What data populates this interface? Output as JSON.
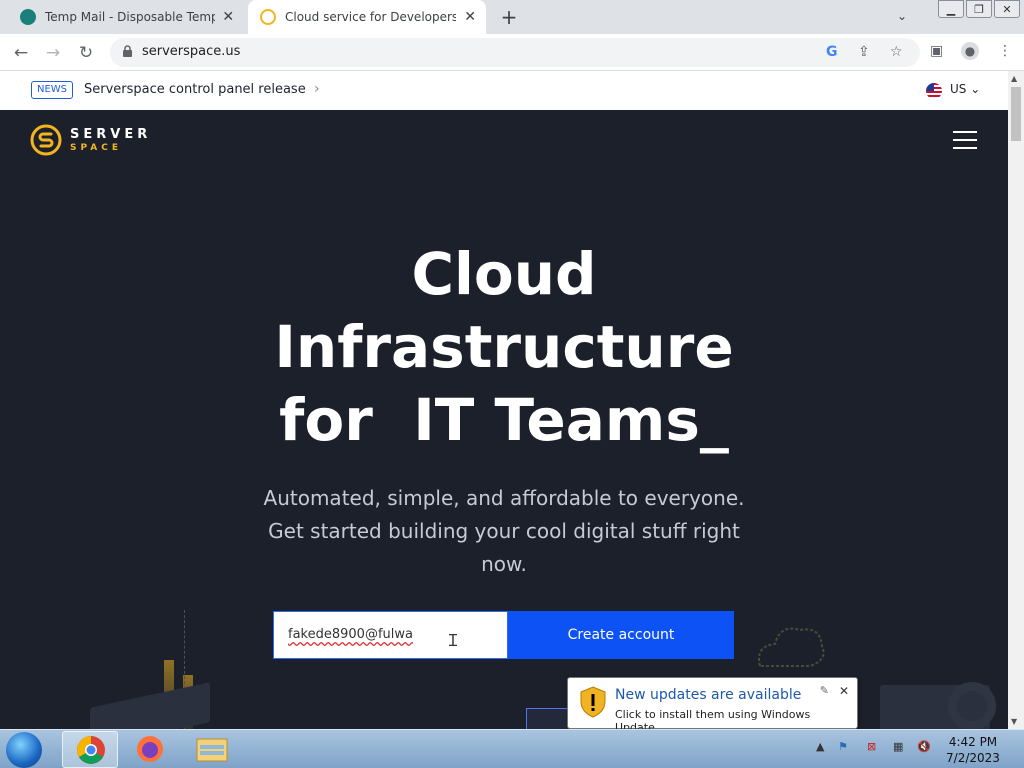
{
  "browser": {
    "tabs": [
      {
        "title": "Temp Mail - Disposable Tempora",
        "active": false
      },
      {
        "title": "Cloud service for Developers in t",
        "active": true
      }
    ],
    "new_tab": "+",
    "url": "serverspace.us"
  },
  "newsbar": {
    "badge": "NEWS",
    "text": "Serverspace control panel release",
    "arrow": "›",
    "lang": "US"
  },
  "logo": {
    "line1": "SERVER",
    "line2": "SPACE"
  },
  "hero": {
    "headline": [
      "Cloud",
      "Infrastructure",
      "for  IT Teams_"
    ],
    "subtext": "Automated, simple, and affordable to everyone. Get started building your cool digital stuff right now.",
    "email_value": "fakede8900@fulwa",
    "cta_label": "Create account"
  },
  "notification": {
    "title": "New updates are available",
    "body": "Click to install them using Windows Update."
  },
  "taskbar": {
    "time": "4:42 PM",
    "date": "7/2/2023"
  },
  "colors": {
    "hero_bg": "#1b202b",
    "accent_blue": "#0c52f5",
    "logo_gold": "#f2b51f"
  }
}
